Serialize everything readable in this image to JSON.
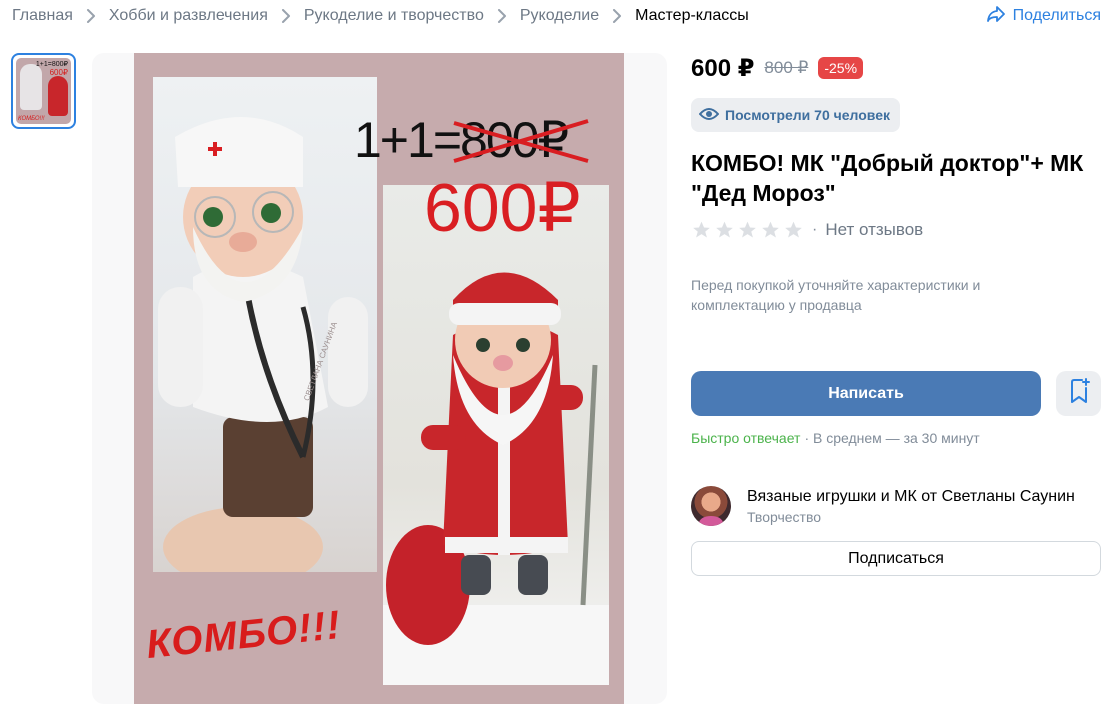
{
  "breadcrumb": {
    "items": [
      "Главная",
      "Хобби и развлечения",
      "Рукоделие и творчество",
      "Рукоделие",
      "Мастер-классы"
    ],
    "share_label": "Поделиться"
  },
  "product": {
    "price": "600 ₽",
    "old_price": "800 ₽",
    "discount": "-25%",
    "views": "Посмотрели 70 человек",
    "title": "КОМБО! МК \"Добрый доктор\"+ МК \"Дед Мороз\"",
    "rating_text": "Нет отзывов",
    "stars_filled": 0,
    "stars_total": 5,
    "hint": "Перед покупкой уточняйте характеристики и комплектацию у продавца"
  },
  "image": {
    "promo_formula": "1+1=800₽",
    "promo_price": "600₽",
    "promo_combo": "КОМБО!!!",
    "watermark": "СВЕТЛАНА САУНИНА"
  },
  "thumbnail": {
    "line1": "1+1=800₽",
    "line2": "600₽",
    "line3": "КОМБО!!!"
  },
  "actions": {
    "write_label": "Написать",
    "subscribe_label": "Подписаться"
  },
  "response": {
    "fast": "Быстро отвечает",
    "average": "· В среднем — за 30 минут"
  },
  "seller": {
    "name": "Вязаные игрушки и МК от Светланы Саунин",
    "category": "Творчество"
  },
  "colors": {
    "accent": "#2d81e0",
    "button": "#4a7ab5",
    "discount": "#e64646",
    "fast_reply": "#4bb34b",
    "poster_bg": "#c6abad",
    "promo_red": "#d91e22"
  }
}
